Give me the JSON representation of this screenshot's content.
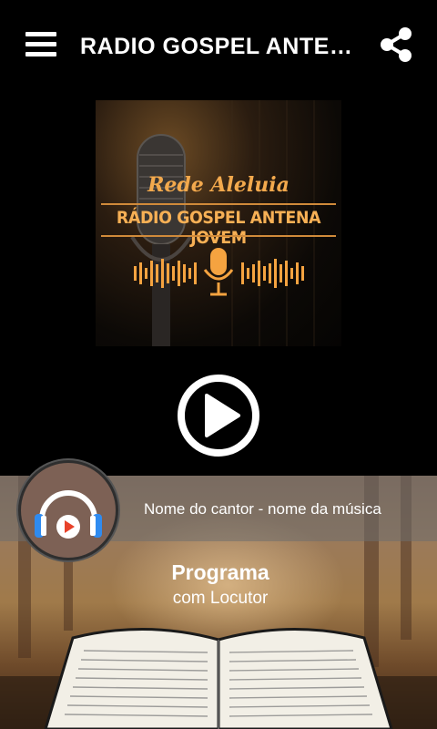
{
  "header": {
    "title": "RADIO GOSPEL ANTENA JOVEM",
    "menu_icon": "hamburger-menu-icon",
    "share_icon": "share-icon"
  },
  "cover": {
    "subtitle": "Rede Aleluia",
    "title": "RÁDIO GOSPEL ANTENA JOVEM",
    "accent_color": "#f7b055"
  },
  "player": {
    "play_icon": "play-icon",
    "now_playing": "Nome do cantor - nome da música",
    "logo_icon": "headphones-icon"
  },
  "program": {
    "name": "Programa",
    "host": "com Locutor"
  }
}
